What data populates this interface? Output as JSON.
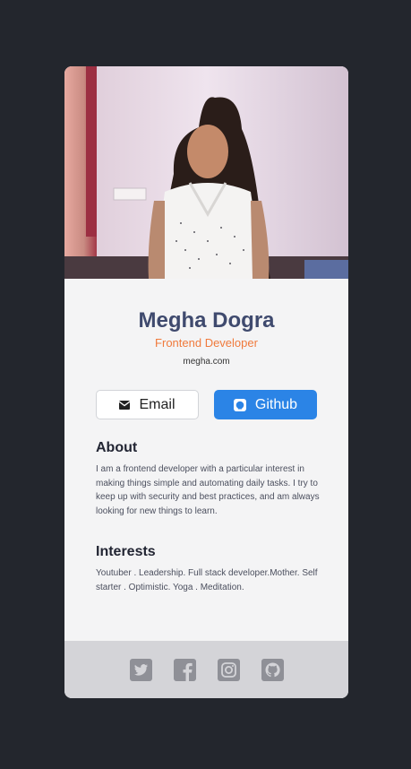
{
  "profile": {
    "name": "Megha Dogra",
    "role": "Frontend Developer",
    "website": "megha.com",
    "photo_alt": "Megha Dogra"
  },
  "buttons": {
    "email_label": "Email",
    "github_label": "Github"
  },
  "about": {
    "title": "About",
    "text": "I am a frontend developer with a particular interest in making things simple and automating daily tasks. I try to keep up with security and best practices, and am always looking for new things to learn."
  },
  "interests": {
    "title": "Interests",
    "text": "Youtuber . Leadership. Full stack developer.Mother. Self starter . Optimistic. Yoga . Meditation."
  },
  "footer": {
    "icons": [
      "twitter-icon",
      "facebook-icon",
      "instagram-icon",
      "github-icon"
    ]
  },
  "colors": {
    "page_background": "#23262d",
    "card_background": "#f4f4f5",
    "name": "#3f4a6e",
    "role_accent": "#f07a3c",
    "github_button": "#2b84e6",
    "footer_background": "#d4d4d8",
    "footer_icon": "#8f9097"
  }
}
